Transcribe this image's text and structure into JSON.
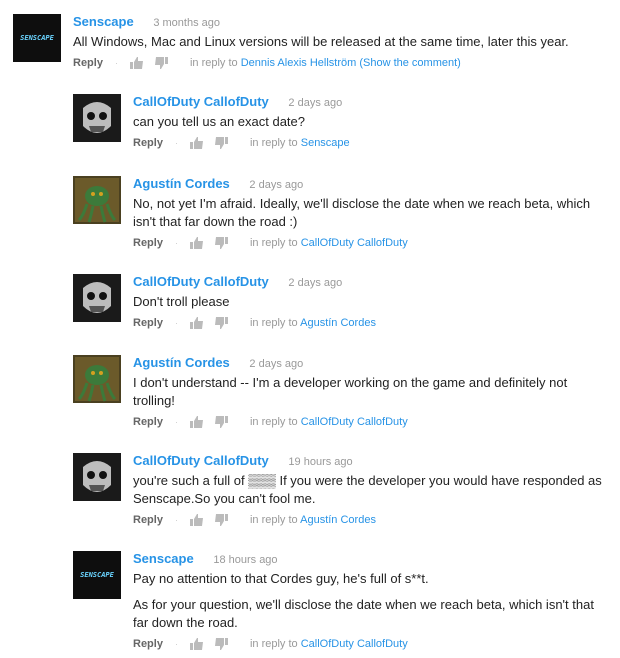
{
  "comments": [
    {
      "author": "Senscape",
      "time": "3 months ago",
      "avatar_text": "SENSCAPE",
      "text": [
        "All Windows, Mac and Linux versions will be released at the same time, later this year."
      ],
      "reply_label": "Reply",
      "in_reply_to": "in reply to",
      "reply_target": "Dennis Alexis Hellström",
      "show_comment": "(Show the comment)"
    },
    {
      "author": "CallOfDuty CallofDuty",
      "time": "2 days ago",
      "text": [
        "can you tell us an exact date?"
      ],
      "reply_label": "Reply",
      "in_reply_to": "in reply to",
      "reply_target": "Senscape"
    },
    {
      "author": "Agustín Cordes",
      "time": "2 days ago",
      "text": [
        "No, not yet I'm afraid. Ideally, we'll disclose the date when we reach beta, which isn't that far down the road :)"
      ],
      "reply_label": "Reply",
      "in_reply_to": "in reply to",
      "reply_target": "CallOfDuty CallofDuty"
    },
    {
      "author": "CallOfDuty CallofDuty",
      "time": "2 days ago",
      "text": [
        "Don't troll please"
      ],
      "reply_label": "Reply",
      "in_reply_to": "in reply to",
      "reply_target": "Agustín Cordes"
    },
    {
      "author": "Agustín Cordes",
      "time": "2 days ago",
      "text": [
        "I don't understand -- I'm a developer working on the game and definitely not trolling!"
      ],
      "reply_label": "Reply",
      "in_reply_to": "in reply to",
      "reply_target": "CallOfDuty CallofDuty"
    },
    {
      "author": "CallOfDuty CallofDuty",
      "time": "19 hours ago",
      "text": [
        "you're such a full of ▒▒▒ If you were the developer you would have responded as Senscape.So you can't fool me."
      ],
      "reply_label": "Reply",
      "in_reply_to": "in reply to",
      "reply_target": "Agustín Cordes"
    },
    {
      "author": "Senscape",
      "time": "18 hours ago",
      "avatar_text": "SENSCAPE",
      "text": [
        "Pay no attention to that Cordes guy, he's full of s**t.",
        "As for your question, we'll disclose the date when we reach beta, which isn't that far down the road."
      ],
      "reply_label": "Reply",
      "in_reply_to": "in reply to",
      "reply_target": "CallOfDuty CallofDuty"
    }
  ],
  "colors": {
    "link": "#2793e6",
    "meta": "#999999",
    "text": "#222222"
  },
  "icons": {
    "like": "thumbs-up-icon",
    "dislike": "thumbs-down-icon"
  }
}
